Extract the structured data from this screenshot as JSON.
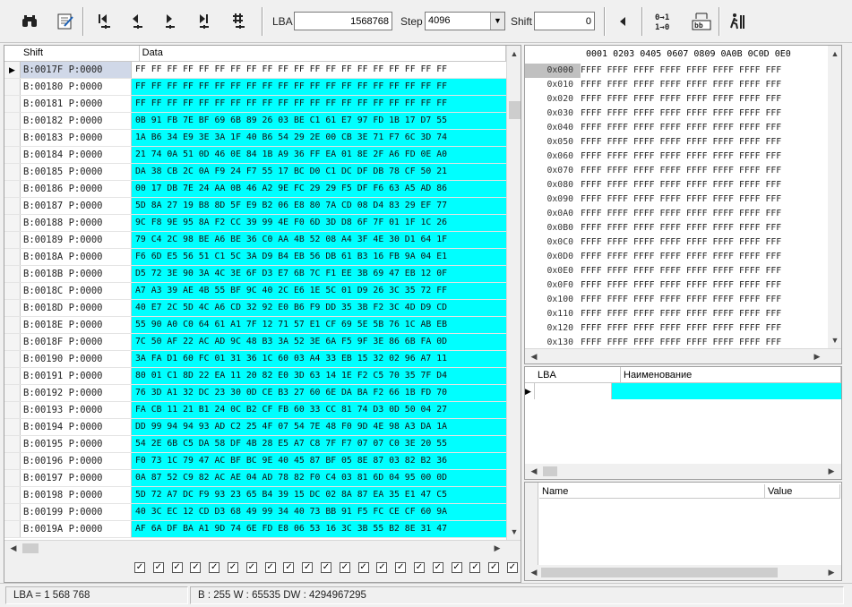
{
  "toolbar": {
    "icons": [
      "binoculars-icon",
      "notepad-icon",
      "first-icon",
      "prev-icon",
      "next-icon",
      "last-icon",
      "hash-icon",
      "left-arrow-icon",
      "convert-icon",
      "compare-icon",
      "run-icon"
    ],
    "lba_label": "LBA",
    "lba_value": "1568768",
    "step_label": "Step",
    "step_value": "4096",
    "shift_label": "Shift",
    "shift_value": "0"
  },
  "left_table": {
    "col_shift": "Shift",
    "col_data": "Data",
    "rows": [
      {
        "shift": "B:0017F P:0000",
        "data": "FF FF FF FF FF FF FF FF FF FF FF FF FF FF FF FF FF FF FF FF"
      },
      {
        "shift": "B:00180 P:0000",
        "data": "FF FF FF FF FF FF FF FF FF FF FF FF FF FF FF FF FF FF FF FF"
      },
      {
        "shift": "B:00181 P:0000",
        "data": "FF FF FF FF FF FF FF FF FF FF FF FF FF FF FF FF FF FF FF FF"
      },
      {
        "shift": "B:00182 P:0000",
        "data": "0B 91 FB 7E BF 69 6B 89 26 03 BE C1 61 E7 97 FD 1B 17 D7 55"
      },
      {
        "shift": "B:00183 P:0000",
        "data": "1A B6 34 E9 3E 3A 1F 40 B6 54 29 2E 00 CB 3E 71 F7 6C 3D 74"
      },
      {
        "shift": "B:00184 P:0000",
        "data": "21 74 0A 51 0D 46 0E 84 1B A9 36 FF EA 01 8E 2F A6 FD 0E A0"
      },
      {
        "shift": "B:00185 P:0000",
        "data": "DA 38 CB 2C 0A F9 24 F7 55 17 BC D0 C1 DC DF DB 78 CF 50 21"
      },
      {
        "shift": "B:00186 P:0000",
        "data": "00 17 DB 7E 24 AA 0B 46 A2 9E FC 29 29 F5 DF F6 63 A5 AD 86"
      },
      {
        "shift": "B:00187 P:0000",
        "data": "5D 8A 27 19 B8 8D 5F E9 B2 06 E8 80 7A CD 08 D4 83 29 EF 77"
      },
      {
        "shift": "B:00188 P:0000",
        "data": "9C F8 9E 95 8A F2 CC 39 99 4E F0 6D 3D D8 6F 7F 01 1F 1C 26"
      },
      {
        "shift": "B:00189 P:0000",
        "data": "79 C4 2C 98 BE A6 BE 36 C0 AA 4B 52 08 A4 3F 4E 30 D1 64 1F"
      },
      {
        "shift": "B:0018A P:0000",
        "data": "F6 6D E5 56 51 C1 5C 3A D9 B4 EB 56 DB 61 B3 16 FB 9A 04 E1"
      },
      {
        "shift": "B:0018B P:0000",
        "data": "D5 72 3E 90 3A 4C 3E 6F D3 E7 6B 7C F1 EE 3B 69 47 EB 12 0F"
      },
      {
        "shift": "B:0018C P:0000",
        "data": "A7 A3 39 AE 4B 55 BF 9C 40 2C E6 1E 5C 01 D9 26 3C 35 72 FF"
      },
      {
        "shift": "B:0018D P:0000",
        "data": "40 E7 2C 5D 4C A6 CD 32 92 E0 B6 F9 DD 35 3B F2 3C 4D D9 CD"
      },
      {
        "shift": "B:0018E P:0000",
        "data": "55 90 A0 C0 64 61 A1 7F 12 71 57 E1 CF 69 5E 5B 76 1C AB EB"
      },
      {
        "shift": "B:0018F P:0000",
        "data": "7C 50 AF 22 AC AD 9C 48 B3 3A 52 3E 6A F5 9F 3E 86 6B FA 0D"
      },
      {
        "shift": "B:00190 P:0000",
        "data": "3A FA D1 60 FC 01 31 36 1C 60 03 A4 33 EB 15 32 02 96 A7 11"
      },
      {
        "shift": "B:00191 P:0000",
        "data": "80 01 C1 8D 22 EA 11 20 82 E0 3D 63 14 1E F2 C5 70 35 7F D4"
      },
      {
        "shift": "B:00192 P:0000",
        "data": "76 3D A1 32 DC 23 30 0D CE B3 27 60 6E DA BA F2 66 1B FD 70"
      },
      {
        "shift": "B:00193 P:0000",
        "data": "FA CB 11 21 B1 24 0C B2 CF FB 60 33 CC 81 74 D3 0D 50 04 27"
      },
      {
        "shift": "B:00194 P:0000",
        "data": "DD 99 94 94 93 AD C2 25 4F 07 54 7E 48 F0 9D 4E 98 A3 DA 1A"
      },
      {
        "shift": "B:00195 P:0000",
        "data": "54 2E 6B C5 DA 58 DF 4B 28 E5 A7 C8 7F F7 07 07 C0 3E 20 55"
      },
      {
        "shift": "B:00196 P:0000",
        "data": "F0 73 1C 79 47 AC BF BC 9E 40 45 87 BF 05 8E 87 03 82 B2 36"
      },
      {
        "shift": "B:00197 P:0000",
        "data": "0A 87 52 C9 82 AC AE 04 AD 78 82 F0 C4 03 81 6D 04 95 00 0D"
      },
      {
        "shift": "B:00198 P:0000",
        "data": "5D 72 A7 DC F9 93 23 65 B4 39 15 DC 02 8A 87 EA 35 E1 47 C5"
      },
      {
        "shift": "B:00199 P:0000",
        "data": "40 3C EC 12 CD D3 68 49 99 34 40 73 BB 91 F5 FC CE CF 60 9A"
      },
      {
        "shift": "B:0019A P:0000",
        "data": "AF 6A DF BA A1 9D 74 6E FD E8 06 53 16 3C 3B 55 B2 8E 31 47"
      }
    ]
  },
  "hex_view": {
    "header": "0001 0203 0405 0607 0809 0A0B 0C0D 0E0",
    "rows": [
      {
        "off": "0x000",
        "vals": "FFFF FFFF FFFF FFFF FFFF FFFF FFFF FFF"
      },
      {
        "off": "0x010",
        "vals": "FFFF FFFF FFFF FFFF FFFF FFFF FFFF FFF"
      },
      {
        "off": "0x020",
        "vals": "FFFF FFFF FFFF FFFF FFFF FFFF FFFF FFF"
      },
      {
        "off": "0x030",
        "vals": "FFFF FFFF FFFF FFFF FFFF FFFF FFFF FFF"
      },
      {
        "off": "0x040",
        "vals": "FFFF FFFF FFFF FFFF FFFF FFFF FFFF FFF"
      },
      {
        "off": "0x050",
        "vals": "FFFF FFFF FFFF FFFF FFFF FFFF FFFF FFF"
      },
      {
        "off": "0x060",
        "vals": "FFFF FFFF FFFF FFFF FFFF FFFF FFFF FFF"
      },
      {
        "off": "0x070",
        "vals": "FFFF FFFF FFFF FFFF FFFF FFFF FFFF FFF"
      },
      {
        "off": "0x080",
        "vals": "FFFF FFFF FFFF FFFF FFFF FFFF FFFF FFF"
      },
      {
        "off": "0x090",
        "vals": "FFFF FFFF FFFF FFFF FFFF FFFF FFFF FFF"
      },
      {
        "off": "0x0A0",
        "vals": "FFFF FFFF FFFF FFFF FFFF FFFF FFFF FFF"
      },
      {
        "off": "0x0B0",
        "vals": "FFFF FFFF FFFF FFFF FFFF FFFF FFFF FFF"
      },
      {
        "off": "0x0C0",
        "vals": "FFFF FFFF FFFF FFFF FFFF FFFF FFFF FFF"
      },
      {
        "off": "0x0D0",
        "vals": "FFFF FFFF FFFF FFFF FFFF FFFF FFFF FFF"
      },
      {
        "off": "0x0E0",
        "vals": "FFFF FFFF FFFF FFFF FFFF FFFF FFFF FFF"
      },
      {
        "off": "0x0F0",
        "vals": "FFFF FFFF FFFF FFFF FFFF FFFF FFFF FFF"
      },
      {
        "off": "0x100",
        "vals": "FFFF FFFF FFFF FFFF FFFF FFFF FFFF FFF"
      },
      {
        "off": "0x110",
        "vals": "FFFF FFFF FFFF FFFF FFFF FFFF FFFF FFF"
      },
      {
        "off": "0x120",
        "vals": "FFFF FFFF FFFF FFFF FFFF FFFF FFFF FFF"
      },
      {
        "off": "0x130",
        "vals": "FFFF FFFF FFFF FFFF FFFF FFFF FFFF FFF"
      }
    ]
  },
  "lba_list": {
    "col_lba": "LBA",
    "col_name": "Наименование"
  },
  "props": {
    "col_name": "Name",
    "col_value": "Value"
  },
  "status": {
    "lba_text": "LBA = 1 568 768",
    "values_text": "B : 255 W : 65535 DW : 4294967295"
  },
  "colors": {
    "data_highlight": "#00ffff",
    "selected_row": "#d0d8e8"
  }
}
